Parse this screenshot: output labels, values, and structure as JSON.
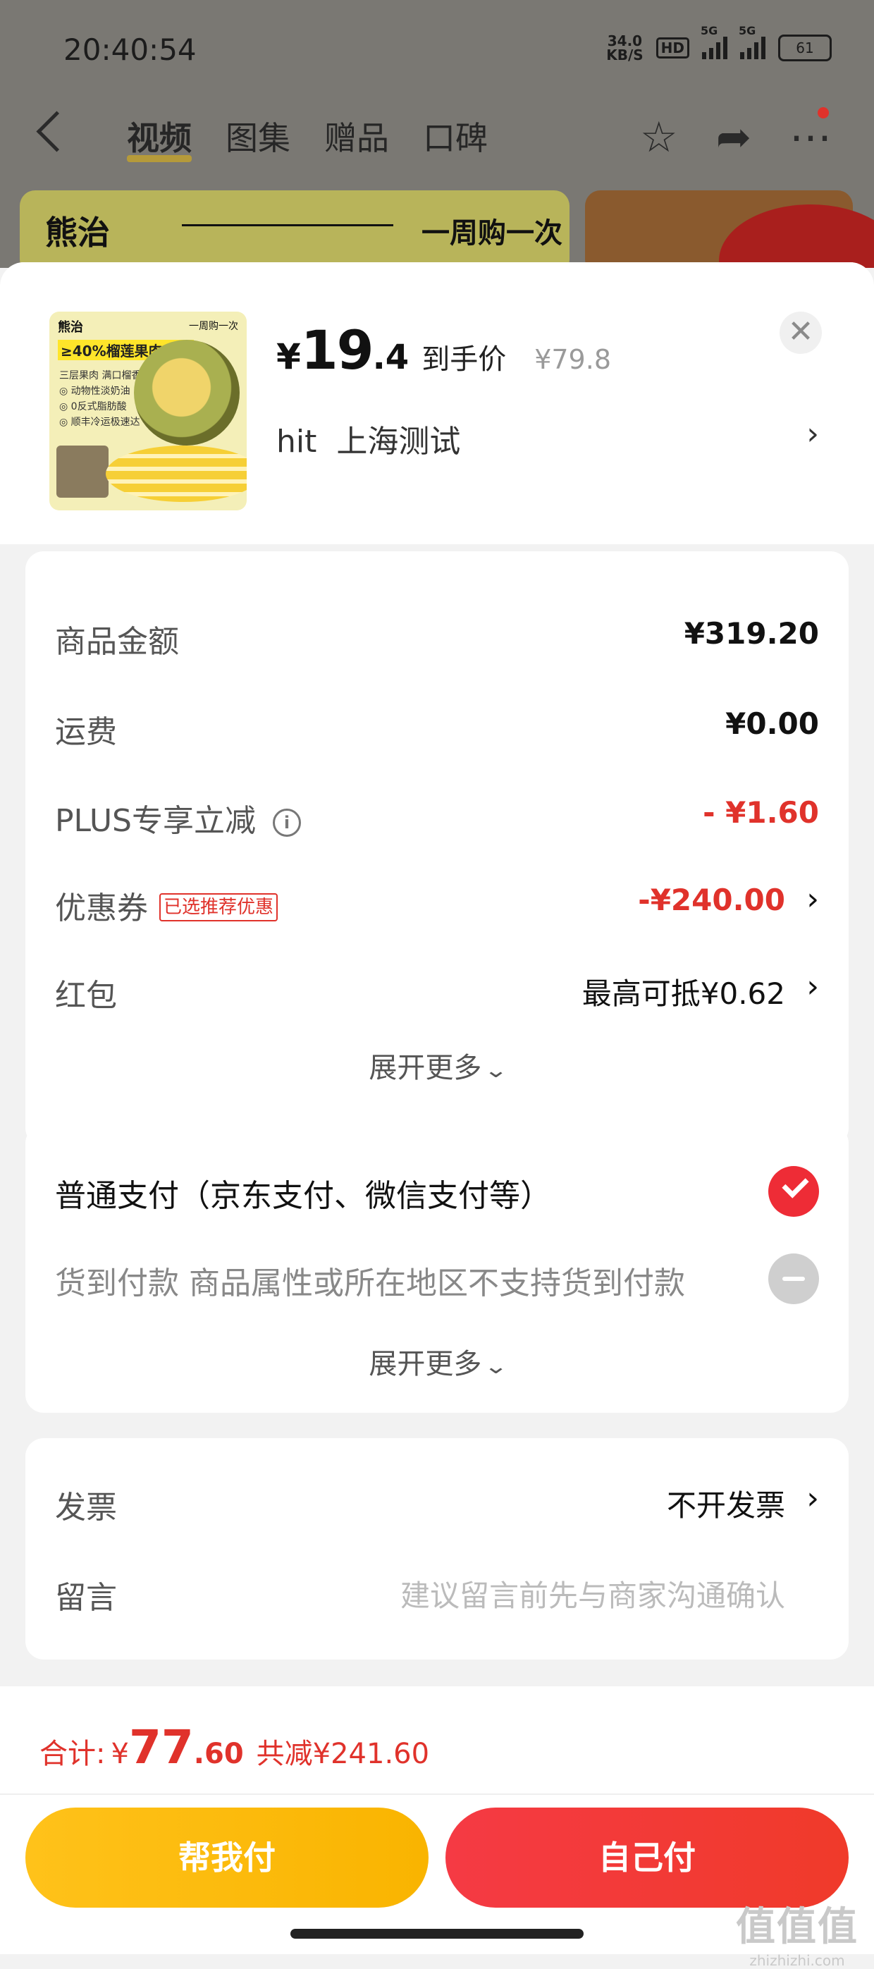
{
  "status_bar": {
    "time": "20:40:54",
    "net_speed_value": "34.0",
    "net_speed_unit": "KB/S",
    "hd": "HD",
    "sim1": "5G",
    "sim2": "5G",
    "battery": "61"
  },
  "top_nav": {
    "tabs": [
      "视频",
      "图集",
      "赠品",
      "口碑"
    ],
    "active_tab": "视频",
    "icons": [
      "back-icon",
      "star-icon",
      "share-icon",
      "more-icon"
    ]
  },
  "banner": {
    "brand": "熊治",
    "slogan": "一周购一次"
  },
  "product": {
    "thumb_brand": "熊治",
    "thumb_slogan": "一周购一次",
    "thumb_pct": "≥40%榴莲果肉含量",
    "thumb_features": "三层果肉 满口榴香\n◎ 动物性淡奶油\n◎ 0反式脂肪酸\n◎ 顺丰冷运极速达",
    "price_yen": "¥",
    "price_int": "19",
    "price_dec": ".4",
    "price_label": "到手价",
    "original_price": "¥79.8",
    "address": "hit  上海测试"
  },
  "fees": {
    "goods_label": "商品金额",
    "goods_value": "¥319.20",
    "shipping_label": "运费",
    "shipping_value": "¥0.00",
    "plus_label": "PLUS专享立减",
    "plus_value": "- ¥1.60",
    "coupon_label": "优惠券",
    "coupon_tag": "已选推荐优惠",
    "coupon_value": "-¥240.00",
    "redpacket_label": "红包",
    "redpacket_value": "最高可抵¥0.62",
    "expand_label": "展开更多"
  },
  "payment": {
    "normal_label": "普通支付（京东支付、微信支付等）",
    "cod_label": "货到付款 商品属性或所在地区不支持货到付款",
    "expand_label": "展开更多"
  },
  "extra": {
    "invoice_label": "发票",
    "invoice_value": "不开发票",
    "memo_label": "留言",
    "memo_placeholder": "建议留言前先与商家沟通确认"
  },
  "footer": {
    "total_label": "合计:",
    "total_yen": "¥",
    "total_int": "77",
    "total_dec": ".60",
    "saved": "共减¥241.60",
    "help_pay": "帮我付",
    "self_pay": "自己付"
  },
  "watermark": {
    "top": "值值值",
    "bottom": "zhizhizhi.com"
  },
  "colors": {
    "accent_red": "#e0322b",
    "check_red": "#ee2c36",
    "help_yellow": "#ffc21a",
    "self_red": "#f53a44"
  }
}
